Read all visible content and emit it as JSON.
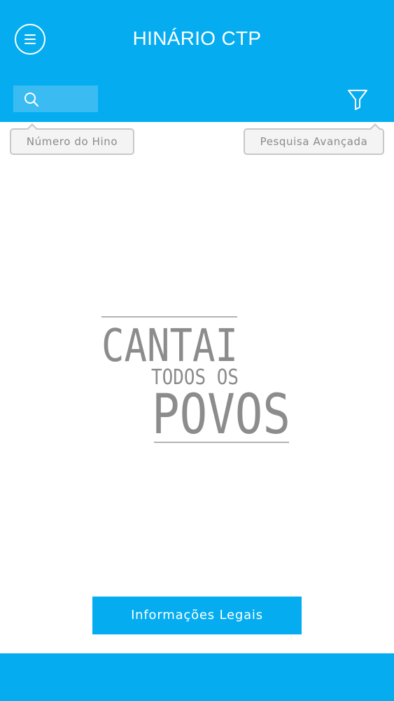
{
  "header": {
    "title": "HINÁRIO CTP",
    "menu_icon": "hamburger-menu-icon",
    "search_icon": "search-icon",
    "filter_icon": "funnel-filter-icon",
    "search_value": ""
  },
  "tooltips": {
    "hymn_number": "Número do Hino",
    "advanced_search": "Pesquisa Avançada"
  },
  "logo": {
    "line1": "CANTAI",
    "line2": "TODOS OS",
    "line3": "POVOS"
  },
  "footer_actions": {
    "legal_info": "Informações Legais"
  },
  "colors": {
    "accent": "#05adf0",
    "search_field": "#3abcf3",
    "tooltip_text": "#8a8a8a",
    "logo_text": "#8c8c8c"
  }
}
